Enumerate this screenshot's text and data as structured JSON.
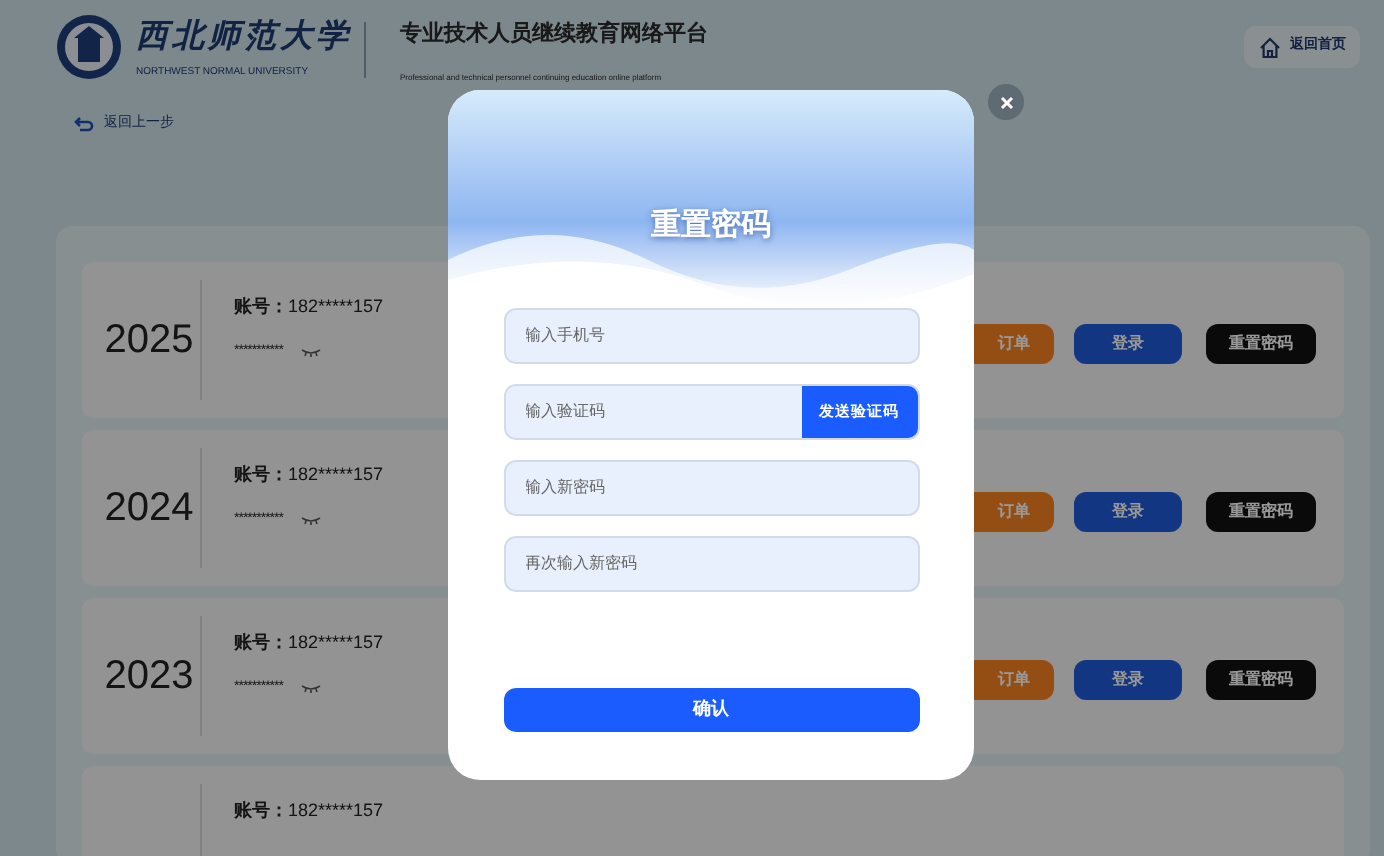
{
  "header": {
    "university_name": "西北师范大学",
    "university_name_en": "NORTHWEST NORMAL UNIVERSITY",
    "platform_title": "专业技术人员继续教育网络平台",
    "platform_subtitle": "Professional and technical personnel continuing education online platform"
  },
  "home_button": "返回首页",
  "back_link": "返回上一步",
  "accounts": [
    {
      "year": "2025",
      "account_label": "账号：",
      "account": "182*****157",
      "password": "***********",
      "buttons": [
        "订单",
        "登录",
        "重置密码"
      ]
    },
    {
      "year": "2024",
      "account_label": "账号：",
      "account": "182*****157",
      "password": "***********",
      "buttons": [
        "订单",
        "登录",
        "重置密码"
      ]
    },
    {
      "year": "2023",
      "account_label": "账号：",
      "account": "182*****157",
      "password": "***********",
      "buttons": [
        "订单",
        "登录",
        "重置密码"
      ]
    },
    {
      "account_label": "账号：",
      "account": "182*****157"
    }
  ],
  "modal": {
    "title": "重置密码",
    "fields": [
      {
        "kind": "text",
        "placeholder": "输入手机号"
      },
      {
        "kind": "code",
        "placeholder": "输入验证码",
        "button": "发送验证码"
      },
      {
        "kind": "text",
        "placeholder": "输入新密码"
      },
      {
        "kind": "text",
        "placeholder": "再次输入新密码"
      }
    ],
    "confirm": "确认"
  }
}
